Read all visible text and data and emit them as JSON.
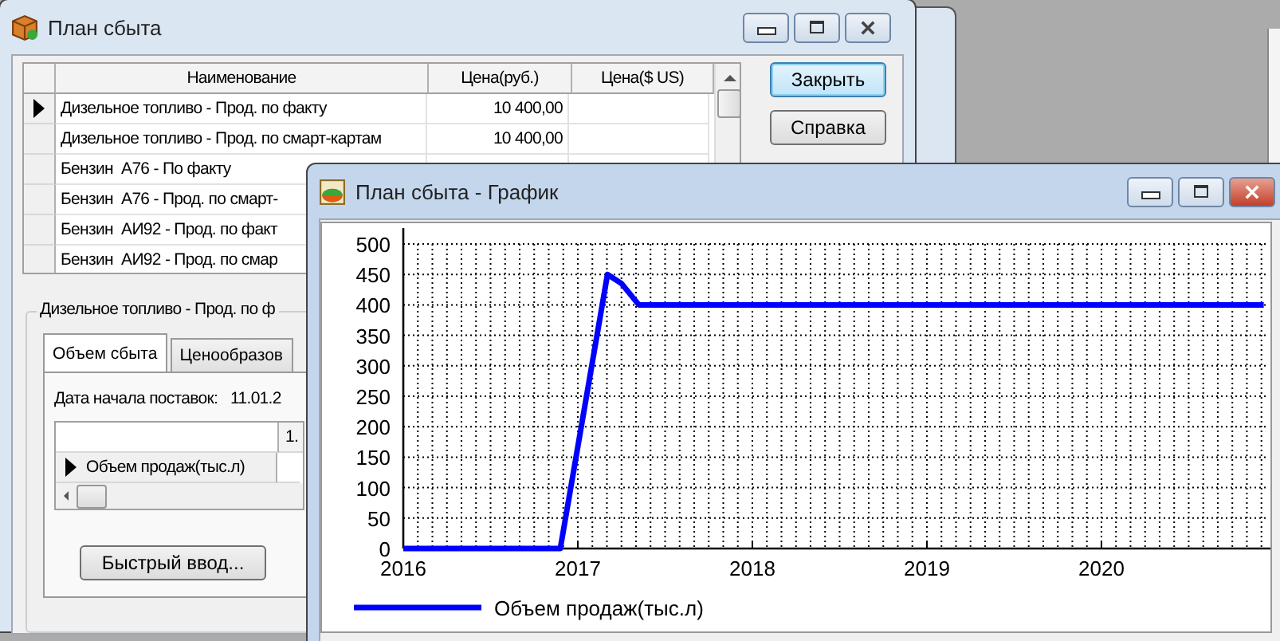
{
  "main_window": {
    "title": "План сбыта",
    "grid": {
      "columns": [
        "Наименование",
        "Цена(руб.)",
        "Цена($ US)"
      ],
      "rows": [
        {
          "name": "Дизельное топливо - Прод. по факту",
          "price": "10 400,00",
          "selected": true
        },
        {
          "name": "Дизельное топливо - Прод. по смарт-картам",
          "price": "10 400,00",
          "selected": false
        },
        {
          "name": "Бензин  А76 - По факту",
          "selected": false
        },
        {
          "name": "Бензин  А76 - Прод. по смарт-",
          "selected": false
        },
        {
          "name": "Бензин  АИ92 - Прод. по факт",
          "selected": false
        },
        {
          "name": "Бензин  АИ92 - Прод. по смар",
          "selected": false
        }
      ]
    },
    "buttons": [
      {
        "label": "Закрыть",
        "default": true
      },
      {
        "label": "Справка",
        "default": false
      }
    ],
    "group": {
      "title": "Дизельное топливо - Прод. по ф",
      "tabs": [
        {
          "label": "Объем сбыта",
          "selected": true
        },
        {
          "label": "Ценообразов",
          "selected": false
        }
      ],
      "start_date_label": "Дата начала поставок:",
      "start_date": "11.01.2",
      "subgrid": {
        "columns": [
          "1."
        ],
        "rows": [
          {
            "label": "Объем продаж(тыс.л)",
            "selected": true
          }
        ]
      },
      "quick_button": "Быстрый ввод..."
    }
  },
  "chart_window": {
    "title": "План сбыта - График",
    "chart_data": {
      "type": "line",
      "x": [
        2016,
        2016.9,
        2017.17,
        2017.25,
        2017.35,
        2020.93
      ],
      "series": [
        {
          "name": "Объем продаж(тыс.л)",
          "color": "#0000ff",
          "values": [
            0,
            0,
            450,
            435,
            400,
            400
          ]
        }
      ],
      "xlim": [
        2016,
        2020.95
      ],
      "ylim": [
        0,
        500
      ],
      "grid": true,
      "xticks": [
        2016,
        2017,
        2018,
        2019,
        2020
      ],
      "yticks": [
        0,
        50,
        100,
        150,
        200,
        250,
        300,
        350,
        400,
        450,
        500
      ]
    }
  }
}
